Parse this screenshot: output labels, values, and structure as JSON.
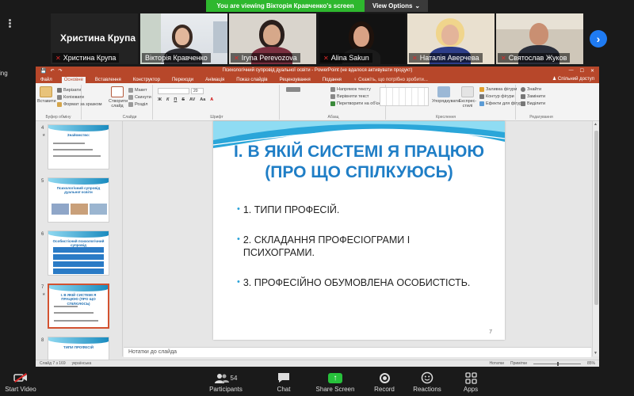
{
  "share_banner": {
    "message": "You are viewing Вікторія Кравченко's screen",
    "options_label": "View Options",
    "options_caret": "⌄"
  },
  "participants": [
    {
      "name": "Христина Крупа",
      "large_label": "Христина Крупа",
      "muted": true
    },
    {
      "name": "Вікторія Кравченко",
      "muted": false,
      "active": true
    },
    {
      "name": "Iryna Perevozova",
      "muted": true
    },
    {
      "name": "Alina Sakun",
      "muted": true
    },
    {
      "name": "Наталія Аверчева",
      "muted": true
    },
    {
      "name": "Святослав Жуков",
      "muted": true
    }
  ],
  "strip_next": "›",
  "left_cut_text": "ing",
  "ppt": {
    "titlebar": {
      "title": "Психологічний супровід дуальної освіти - PowerPoint (не вдалося активувати продукт)",
      "undo": "↶",
      "redo": "↷",
      "save": "💾",
      "win_min": "—",
      "win_max": "☐",
      "win_close": "✕"
    },
    "tabs": [
      "Файл",
      "Основне",
      "Вставлення",
      "Конструктор",
      "Переходи",
      "Анімація",
      "Показ слайдів",
      "Рецензування",
      "Подання"
    ],
    "selected_tab": "Основне",
    "tell_me": "Скажіть, що потрібно зробити...",
    "share_label": "Спільний доступ",
    "ribbon": {
      "clipboard": {
        "name": "Буфер обміну",
        "paste": "Вставити",
        "cut": "Вирізати",
        "copy": "Копіювати",
        "format": "Формат за зразком"
      },
      "slides": {
        "name": "Слайди",
        "new_slide": "Створити слайд",
        "layout": "Макет",
        "reset": "Скинути",
        "section": "Розділ"
      },
      "font": {
        "name": "Шрифт",
        "font_size": "20",
        "bold": "Ж",
        "italic": "К",
        "underline": "П",
        "strike": "S",
        "spacing": "AV",
        "case": "Aa",
        "color": "A"
      },
      "paragraph": {
        "name": "Абзац",
        "direction": "Напрямок тексту",
        "align": "Вирівняти текст",
        "smartart": "Перетворити на об'єкт SmartArt"
      },
      "drawing": {
        "name": "Креслення",
        "arrange": "Упорядкувати",
        "styles": "Експрес-стилі",
        "fill": "Заливка фігури",
        "outline": "Контур фігури",
        "effects": "Ефекти для фігур"
      },
      "editing": {
        "name": "Редагування",
        "find": "Знайти",
        "replace": "Замінити",
        "select": "Виділити"
      }
    },
    "thumbnails": [
      {
        "number": "4",
        "title": "Знайомство:"
      },
      {
        "number": "5",
        "title": "Психологічний супровід дуальної освіти"
      },
      {
        "number": "6",
        "title": "Особистісний психологічний супровід"
      },
      {
        "number": "7",
        "title": "I. В ЯКІЙ СИСТЕМІ Я ПРАЦЮЮ (ПРО ЩО СПІЛКУЮСЬ)"
      },
      {
        "number": "8",
        "title": "ТИПИ ПРОФЕСІЙ"
      }
    ],
    "slide": {
      "title_line1": "I. В ЯКІЙ СИСТЕМІ Я ПРАЦЮЮ",
      "title_line2": "(ПРО ЩО СПІЛКУЮСЬ)",
      "bullets": [
        "1. ТИПИ ПРОФЕСІЙ.",
        "2. СКЛАДАННЯ ПРОФЕСІОГРАМИ І ПСИХОГРАМИ.",
        "3. ПРОФЕСІЙНО ОБУМОВЛЕНА ОСОБИСТІСТЬ."
      ],
      "bullet_glyph": "•",
      "page_number": "7"
    },
    "notes_placeholder": "Нотатки до слайда",
    "status": {
      "slide_info": "Слайд 7 з 169",
      "language": "українська",
      "notes": "Нотатки",
      "comments": "Примітки",
      "zoom": "85%"
    }
  },
  "toolbar": {
    "start_video": "Start Video",
    "participants": "Participants",
    "participants_count": "54",
    "chat": "Chat",
    "share_screen": "Share Screen",
    "record": "Record",
    "reactions": "Reactions",
    "apps": "Apps",
    "caret": "^"
  },
  "colors": {
    "ppt_accent": "#b7472a",
    "slide_title": "#1f7ec6",
    "share_green": "#27c13b",
    "active_speaker": "#d8d300"
  }
}
